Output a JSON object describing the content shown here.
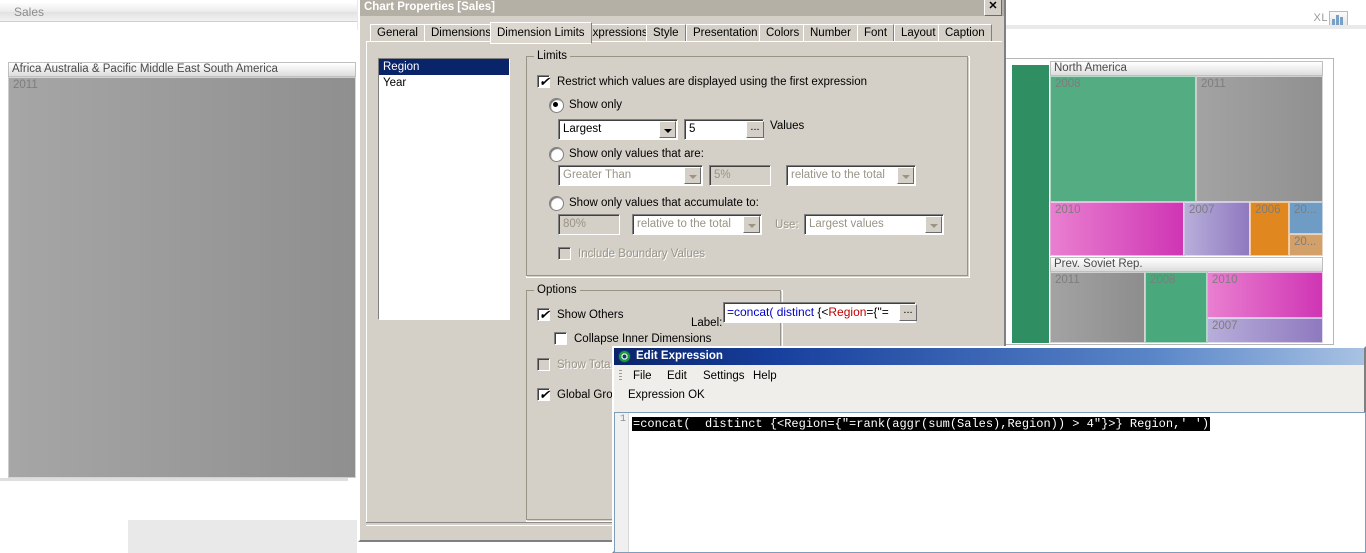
{
  "background": {
    "left_chart": {
      "caption": "Sales",
      "treemap_header": "Africa Australia & Pacific Middle East South America",
      "cell_label": "2011",
      "cell_color": "#9a9a9a"
    },
    "right_chart": {
      "export_label": "XL",
      "export_icon": "excel-export-icon",
      "groups": [
        {
          "header": "North America",
          "cells": [
            {
              "label": "2008",
              "color": "#54ac82"
            },
            {
              "label": "2011",
              "color": "#9d9d9d"
            },
            {
              "label": "2010",
              "color": "#d95fc0"
            },
            {
              "label": "2007",
              "color": "#a08fc8"
            },
            {
              "label": "2006",
              "color": "#e0881f"
            },
            {
              "label": "20...",
              "color": "#6f9cc4"
            },
            {
              "label": "20...",
              "color": "#d4a06a"
            }
          ]
        },
        {
          "header": "Prev. Soviet Rep.",
          "cells": [
            {
              "label": "2011",
              "color": "#9d9d9d"
            },
            {
              "label": "2008",
              "color": "#49a97c"
            },
            {
              "label": "2010",
              "color": "#d95fc0"
            },
            {
              "label": "2007",
              "color": "#a08fc8"
            }
          ]
        },
        {
          "header": "",
          "cells": [
            {
              "label": "",
              "color": "#2f8f62"
            }
          ]
        }
      ]
    }
  },
  "chart_properties": {
    "title": "Chart Properties [Sales]",
    "close_label": "✕",
    "tabs": [
      {
        "label": "General",
        "active": false
      },
      {
        "label": "Dimensions",
        "active": false
      },
      {
        "label": "Dimension Limits",
        "active": true
      },
      {
        "label": "Expressions",
        "active": false
      },
      {
        "label": "Style",
        "active": false
      },
      {
        "label": "Presentation",
        "active": false
      },
      {
        "label": "Colors",
        "active": false
      },
      {
        "label": "Number",
        "active": false
      },
      {
        "label": "Font",
        "active": false
      },
      {
        "label": "Layout",
        "active": false
      },
      {
        "label": "Caption",
        "active": false
      }
    ],
    "dimension_list": [
      {
        "label": "Region",
        "selected": true
      },
      {
        "label": "Year",
        "selected": false
      }
    ],
    "limits": {
      "group_title": "Limits",
      "restrict_checkbox": {
        "label": "Restrict which values are displayed using the first expression",
        "checked": true
      },
      "show_only": {
        "label": "Show only",
        "selected": true,
        "rank_mode": "Largest",
        "count_value": "5",
        "values_suffix": "Values",
        "browse_button": "..."
      },
      "show_values_that_are": {
        "label": "Show only values that are:",
        "selected": false,
        "operator": "Greater Than",
        "threshold": "5%",
        "basis": "relative to the total"
      },
      "show_accumulate": {
        "label": "Show only values that accumulate to:",
        "selected": false,
        "threshold": "80%",
        "basis": "relative to the total",
        "use_label": "Use:",
        "use_value": "Largest values",
        "include_boundary": {
          "label": "Include Boundary Values",
          "checked": false
        }
      }
    },
    "options": {
      "group_title": "Options",
      "show_others": {
        "label": "Show Others",
        "checked": true
      },
      "collapse_inner": {
        "label": "Collapse Inner Dimensions",
        "checked": false
      },
      "show_total": {
        "label": "Show Tota",
        "checked": false
      },
      "global_grouping": {
        "label": "Global Grou",
        "checked": true
      },
      "label_caption": "Label:",
      "label_value_parts": [
        {
          "text": "=concat(",
          "color": "#0000cc"
        },
        {
          "text": "  distinct ",
          "color": "#0000cc"
        },
        {
          "text": "{<",
          "color": "#000000"
        },
        {
          "text": "Region",
          "color": "#c00000"
        },
        {
          "text": "={\"=",
          "color": "#000000"
        }
      ],
      "label_browse_button": "..."
    }
  },
  "edit_expression": {
    "title": "Edit Expression",
    "title_icon": "qlikview-bullseye-icon",
    "menus": [
      "File",
      "Edit",
      "Settings",
      "Help"
    ],
    "status": "Expression OK",
    "line_number": "1",
    "expression": "=concat(  distinct {<Region={\"=rank(aggr(sum(Sales),Region)) > 4\"}>} Region,' ')"
  }
}
